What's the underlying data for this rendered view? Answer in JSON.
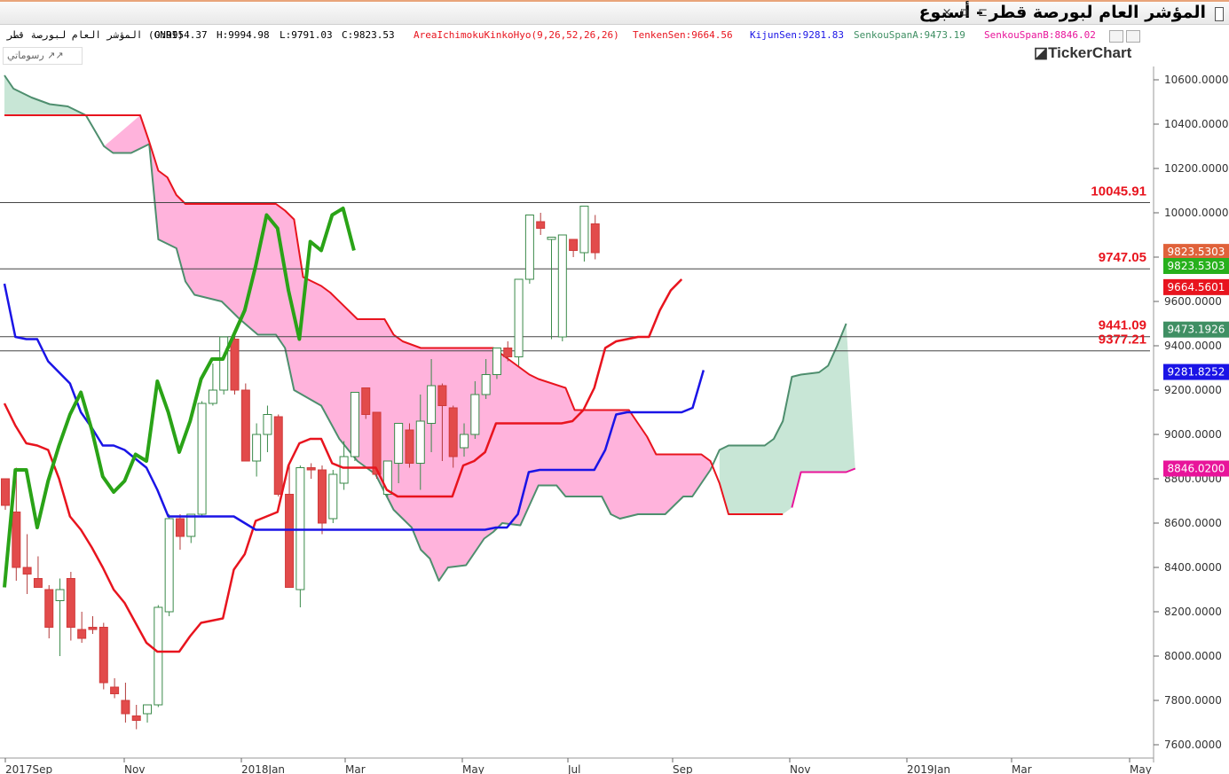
{
  "window": {
    "title": "المؤشر العام لبورصة قطر - أسبوع",
    "controls": [
      "×",
      "⧉",
      "⊏"
    ]
  },
  "infobar": {
    "symbol": "المؤشر العام لبورصة قطر (GNRI)",
    "open": "O:9954.37",
    "high": "H:9994.98",
    "low": "L:9791.03",
    "close": "C:9823.53",
    "indicator": "AreaIchimokuKinkoHyo(9,26,52,26,26)",
    "tenkan": "TenkenSen:9664.56",
    "kijun": "KijunSen:9281.83",
    "spanA": "SenkouSpanA:9473.19",
    "spanB": "SenkouSpanB:8846.02"
  },
  "toolbar": {
    "drawing_label": "رسوماتي ↗↗"
  },
  "brand": "TickerChart",
  "colors": {
    "tenkan": "#e8141e",
    "kijun": "#1a14e6",
    "chikou": "#2aa317",
    "spanA": "#4e8e6e",
    "spanB": "#e8141e",
    "cloud_bear": "#ffb3dc",
    "cloud_bull": "#c8e6d6",
    "candle_down": "#e24b4b",
    "candle_up": "#ffffff"
  },
  "chart_data": {
    "type": "candlestick",
    "x_axis": {
      "labels": [
        "2017Sep",
        "Nov",
        "2018Jan",
        "Mar",
        "May",
        "Jul",
        "Sep",
        "Nov",
        "2019Jan",
        "Mar",
        "May"
      ]
    },
    "y_axis": {
      "range": [
        7550,
        10750
      ],
      "labels": [
        "10600.0000",
        "10400.0000",
        "10200.0000",
        "10000.0000",
        "9800.0000",
        "9600.0000",
        "9400.0000",
        "9200.0000",
        "9000.0000",
        "8800.0000",
        "8600.0000",
        "8400.0000",
        "8200.0000",
        "8000.0000",
        "7800.0000",
        "7600.0000"
      ]
    },
    "horizontal_levels": [
      {
        "value": 10045.91,
        "label": "10045.91"
      },
      {
        "value": 9747.05,
        "label": "9747.05"
      },
      {
        "value": 9441.09,
        "label": "9441.09"
      },
      {
        "value": 9377.21,
        "label": "9377.21"
      }
    ],
    "price_tags": [
      {
        "value": 9823.53,
        "label": "9823.5303",
        "color": "#e0623a"
      },
      {
        "value": 9760,
        "label": "9823.5303",
        "color": "#27b01c"
      },
      {
        "value": 9664.56,
        "label": "9664.5601",
        "color": "#e8141e"
      },
      {
        "value": 9473.19,
        "label": "9473.1926",
        "color": "#3f8f63"
      },
      {
        "value": 9281.83,
        "label": "9281.8252",
        "color": "#1a14e6"
      },
      {
        "value": 8846.02,
        "label": "8846.0200",
        "color": "#e8149a"
      }
    ],
    "candles": [
      [
        8800,
        8800,
        8660,
        8680
      ],
      [
        8650,
        8850,
        8340,
        8400
      ],
      [
        8400,
        8550,
        8280,
        8370
      ],
      [
        8350,
        8450,
        8320,
        8310
      ],
      [
        8300,
        8320,
        8080,
        8130
      ],
      [
        8250,
        8350,
        8000,
        8300
      ],
      [
        8350,
        8380,
        8070,
        8130
      ],
      [
        8120,
        8200,
        8060,
        8080
      ],
      [
        8130,
        8180,
        8100,
        8120
      ],
      [
        8130,
        8150,
        7850,
        7880
      ],
      [
        7860,
        7900,
        7810,
        7830
      ],
      [
        7800,
        7880,
        7700,
        7740
      ],
      [
        7730,
        7780,
        7670,
        7710
      ],
      [
        7740,
        7780,
        7700,
        7780
      ],
      [
        7780,
        8230,
        7770,
        8220
      ],
      [
        8200,
        8640,
        8180,
        8620
      ],
      [
        8620,
        8640,
        8480,
        8540
      ],
      [
        8540,
        8640,
        8510,
        8640
      ],
      [
        8640,
        9150,
        8630,
        9140
      ],
      [
        9140,
        9320,
        9130,
        9200
      ],
      [
        9200,
        9440,
        9180,
        9440
      ],
      [
        9430,
        9440,
        9180,
        9200
      ],
      [
        9200,
        9230,
        8880,
        8880
      ],
      [
        8880,
        9050,
        8810,
        9000
      ],
      [
        9000,
        9130,
        8920,
        9090
      ],
      [
        9080,
        9090,
        8720,
        8730
      ],
      [
        8730,
        8870,
        8650,
        8310
      ],
      [
        8300,
        8860,
        8220,
        8850
      ],
      [
        8850,
        8870,
        8800,
        8840
      ],
      [
        8840,
        8860,
        8550,
        8600
      ],
      [
        8620,
        8840,
        8600,
        8820
      ],
      [
        8780,
        8970,
        8750,
        8900
      ],
      [
        8900,
        9190,
        8880,
        9190
      ],
      [
        9210,
        9210,
        9070,
        9090
      ],
      [
        9100,
        9100,
        8800,
        8820
      ],
      [
        8730,
        8880,
        8720,
        8880
      ],
      [
        8870,
        9050,
        8780,
        9050
      ],
      [
        9020,
        9050,
        8850,
        8870
      ],
      [
        8870,
        9180,
        8750,
        9060
      ],
      [
        9050,
        9340,
        8920,
        9220
      ],
      [
        9220,
        9230,
        8880,
        9130
      ],
      [
        9120,
        9130,
        8850,
        8900
      ],
      [
        8940,
        9050,
        8900,
        9000
      ],
      [
        9000,
        9240,
        8980,
        9180
      ],
      [
        9180,
        9340,
        9160,
        9270
      ],
      [
        9270,
        9360,
        9250,
        9390
      ],
      [
        9390,
        9420,
        9330,
        9350
      ],
      [
        9350,
        9690,
        9310,
        9700
      ],
      [
        9700,
        9990,
        9680,
        9990
      ],
      [
        9960,
        10000,
        9900,
        9930
      ],
      [
        9880,
        9880,
        9430,
        9890
      ],
      [
        9440,
        9900,
        9420,
        9900
      ],
      [
        9880,
        9880,
        9800,
        9830
      ],
      [
        9820,
        10030,
        9780,
        10030
      ],
      [
        9950,
        9990,
        9790,
        9820
      ]
    ]
  }
}
